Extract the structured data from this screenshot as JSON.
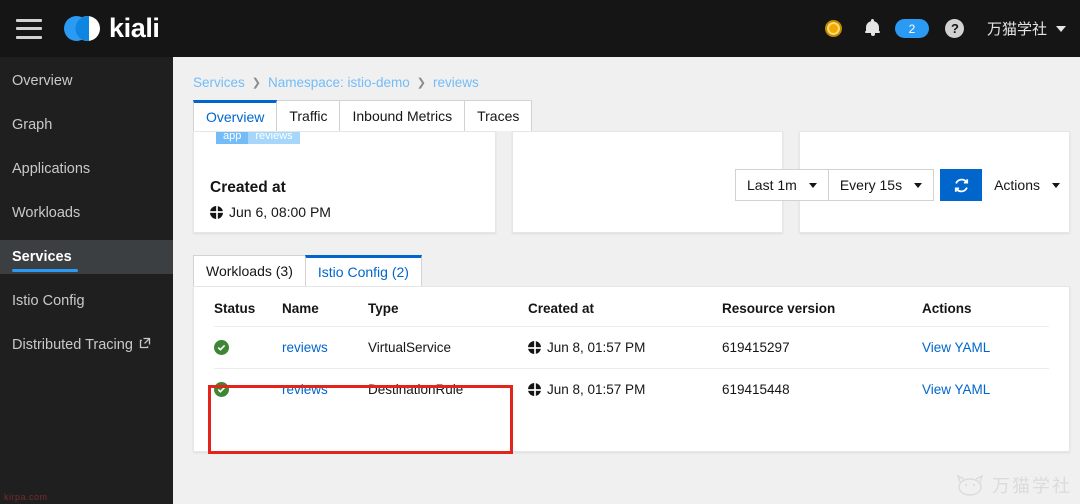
{
  "masthead": {
    "menu_icon": "hamburger-icon",
    "brand": "kiali",
    "status_icon": "status-dot-icon",
    "bell_icon": "bell-icon",
    "notification_count": "2",
    "help_icon": "help-icon",
    "user": "万猫学社",
    "user_caret": "chevron-down-icon"
  },
  "sidebar": {
    "items": [
      {
        "label": "Overview",
        "active": false
      },
      {
        "label": "Graph",
        "active": false
      },
      {
        "label": "Applications",
        "active": false
      },
      {
        "label": "Workloads",
        "active": false
      },
      {
        "label": "Services",
        "active": true
      },
      {
        "label": "Istio Config",
        "active": false
      },
      {
        "label": "Distributed Tracing",
        "active": false,
        "external": true
      }
    ]
  },
  "breadcrumb": {
    "root": "Services",
    "sep": "❯",
    "namespace": "Namespace: istio-demo",
    "current": "reviews"
  },
  "toolbar": {
    "time_range": "Last 1m",
    "refresh_interval": "Every 15s",
    "refresh_icon": "refresh-icon",
    "actions": "Actions"
  },
  "tabs": [
    {
      "label": "Overview",
      "active": true
    },
    {
      "label": "Traffic",
      "active": false
    },
    {
      "label": "Inbound Metrics",
      "active": false
    },
    {
      "label": "Traces",
      "active": false
    }
  ],
  "cards": {
    "label_key": "app",
    "label_value": "reviews",
    "created_heading": "Created at",
    "created_value": "Jun 6, 08:00 PM",
    "created_icon": "globe-icon"
  },
  "sub_tabs": [
    {
      "label": "Workloads (3)",
      "active": false
    },
    {
      "label": "Istio Config (2)",
      "active": true
    }
  ],
  "table": {
    "headers": [
      "Status",
      "Name",
      "Type",
      "Created at",
      "Resource version",
      "Actions"
    ],
    "rows": [
      {
        "status_icon": "check-circle-icon",
        "name": "reviews",
        "type": "VirtualService",
        "created_icon": "globe-icon",
        "created": "Jun 8, 01:57 PM",
        "resource_version": "619415297",
        "action": "View YAML"
      },
      {
        "status_icon": "check-circle-icon",
        "name": "reviews",
        "type": "DestinationRule",
        "created_icon": "globe-icon",
        "created": "Jun 8, 01:57 PM",
        "resource_version": "619415448",
        "action": "View YAML"
      }
    ]
  },
  "annotation": {
    "color": "#e2241a"
  },
  "watermark": {
    "brand_text": "万猫学社",
    "corner_text": "kirpa.com"
  },
  "colors": {
    "accent_blue": "#06c",
    "link_blue": "#73bcf7",
    "status_green": "#3e8635",
    "masthead_bg": "#151515",
    "sidebar_bg": "#1f1f1f"
  }
}
